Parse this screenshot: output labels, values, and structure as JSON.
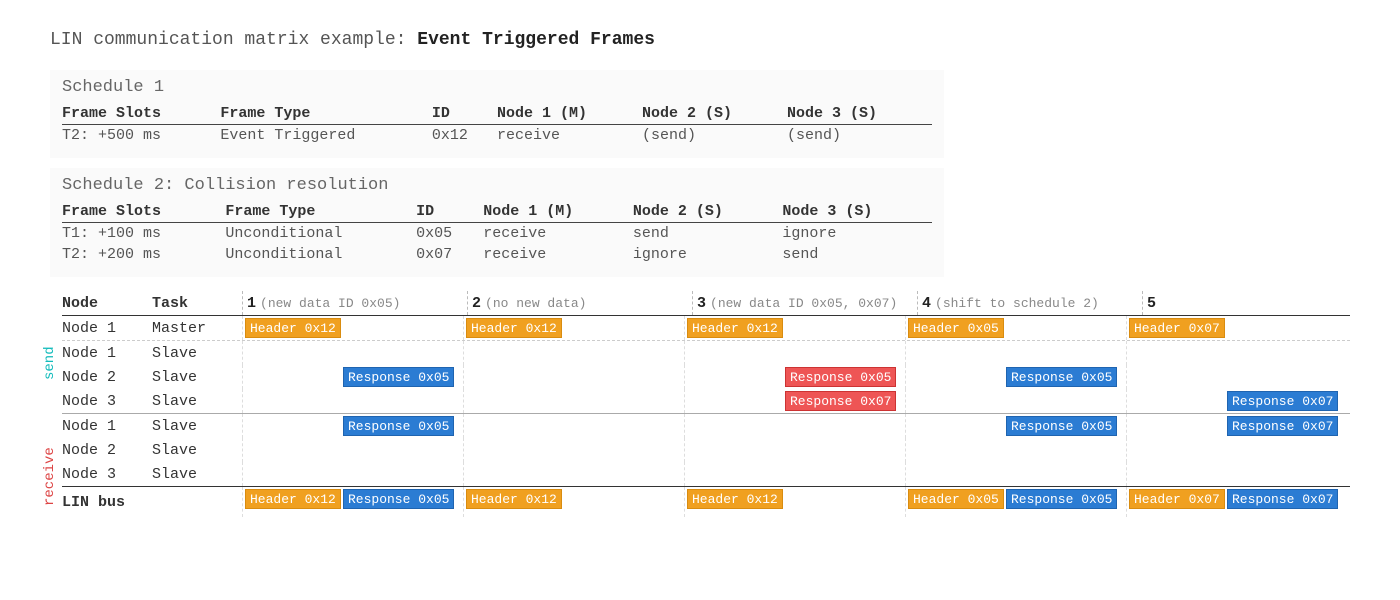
{
  "title_prefix": "LIN communication matrix example:",
  "title_bold": "Event Triggered Frames",
  "sched1": {
    "title": "Schedule 1",
    "headers": [
      "Frame Slots",
      "Frame Type",
      "ID",
      "Node 1 (M)",
      "Node 2 (S)",
      "Node 3 (S)"
    ],
    "rows": [
      {
        "slot": "T2: +500 ms",
        "type": "Event Triggered",
        "id": "0x12",
        "n1": "receive",
        "n2": "(send)",
        "n3": "(send)"
      }
    ]
  },
  "sched2": {
    "title": "Schedule 2: Collision resolution",
    "headers": [
      "Frame Slots",
      "Frame Type",
      "ID",
      "Node 1 (M)",
      "Node 2 (S)",
      "Node 3 (S)"
    ],
    "rows": [
      {
        "slot": "T1: +100 ms",
        "type": "Unconditional",
        "id": "0x05",
        "n1": "receive",
        "n2": "send",
        "n3": "ignore"
      },
      {
        "slot": "T2: +200 ms",
        "type": "Unconditional",
        "id": "0x07",
        "n1": "receive",
        "n2": "ignore",
        "n3": "send"
      }
    ]
  },
  "timing": {
    "col_node": "Node",
    "col_task": "Task",
    "slots": [
      {
        "num": "1",
        "note": "(new data ID 0x05)"
      },
      {
        "num": "2",
        "note": "(no new data)"
      },
      {
        "num": "3",
        "note": "(new data ID 0x05, 0x07)"
      },
      {
        "num": "4",
        "note": "(shift to schedule 2)"
      },
      {
        "num": "5",
        "note": ""
      }
    ],
    "side_send": "send",
    "side_recv": "receive",
    "rows": [
      {
        "node": "Node 1",
        "task": "Master"
      },
      {
        "node": "Node 1",
        "task": "Slave"
      },
      {
        "node": "Node 2",
        "task": "Slave"
      },
      {
        "node": "Node 3",
        "task": "Slave"
      },
      {
        "node": "Node 1",
        "task": "Slave"
      },
      {
        "node": "Node 2",
        "task": "Slave"
      },
      {
        "node": "Node 3",
        "task": "Slave"
      },
      {
        "node": "LIN bus",
        "task": ""
      }
    ],
    "labels": {
      "h12": "Header 0x12",
      "h05": "Header 0x05",
      "h07": "Header 0x07",
      "r05": "Response 0x05",
      "r07": "Response 0x07"
    }
  },
  "colors": {
    "header_badge": "#f0a020",
    "response_badge": "#2b7cd3",
    "collision_badge": "#e55555",
    "send": "#11bbbb",
    "receive": "#dd4444",
    "ignore": "#aaaaaa",
    "id": "#f0a020"
  }
}
